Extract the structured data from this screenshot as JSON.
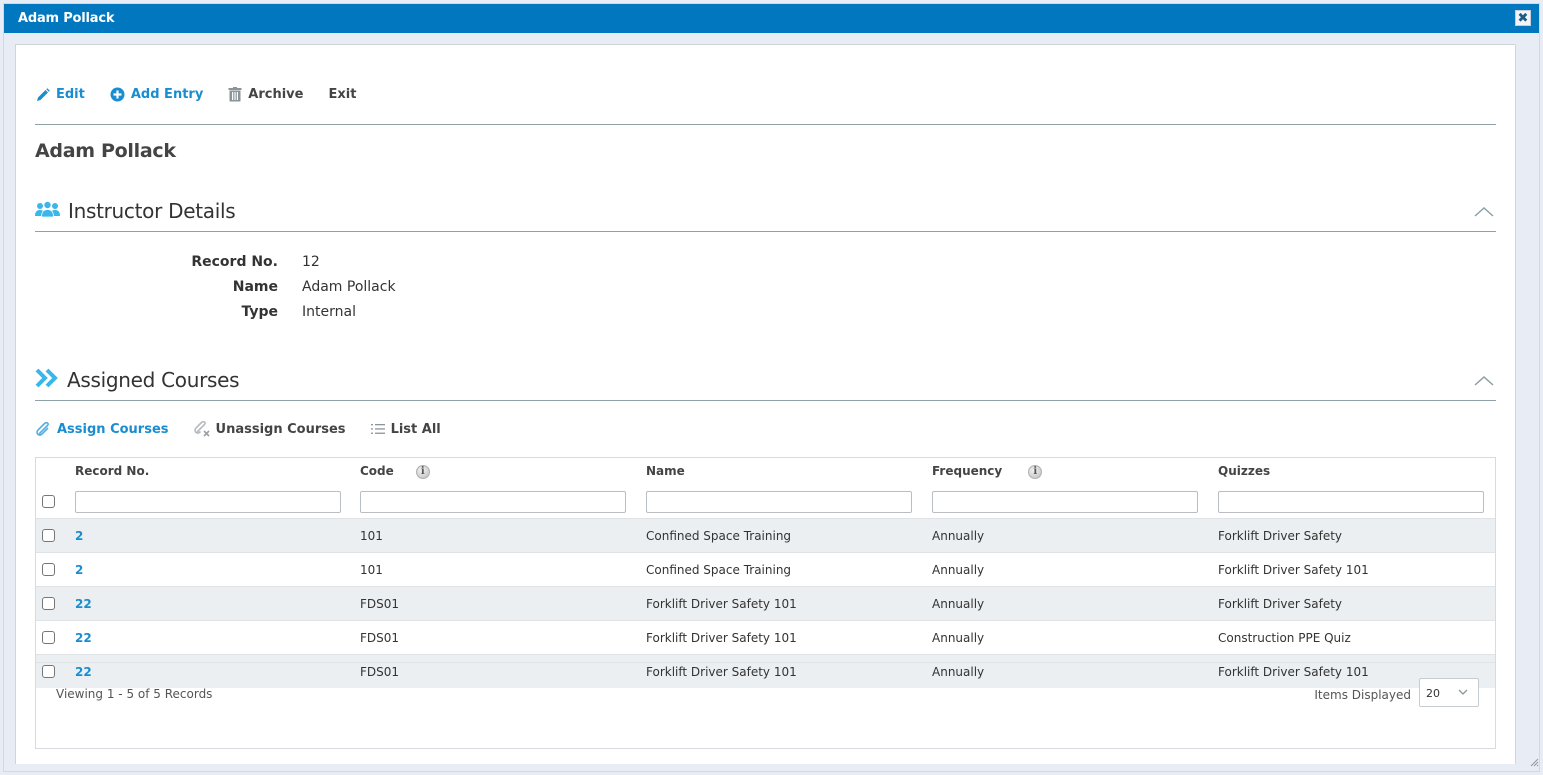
{
  "window": {
    "title": "Adam Pollack",
    "close_icon": "close-icon"
  },
  "toolbar": {
    "edit_label": "Edit",
    "add_entry_label": "Add Entry",
    "archive_label": "Archive",
    "exit_label": "Exit"
  },
  "record_title": "Adam Pollack",
  "instructor_details": {
    "title": "Instructor Details",
    "icon": "users-icon",
    "fields": [
      {
        "label": "Record No.",
        "value": "12"
      },
      {
        "label": "Name",
        "value": "Adam Pollack"
      },
      {
        "label": "Type",
        "value": "Internal"
      }
    ]
  },
  "assigned_courses": {
    "title": "Assigned Courses",
    "icon": "double-chevron-right-icon",
    "actions": {
      "assign_label": "Assign Courses",
      "unassign_label": "Unassign Courses",
      "list_all_label": "List All"
    },
    "columns": [
      {
        "label": "Record No.",
        "info": false
      },
      {
        "label": "Code",
        "info": true
      },
      {
        "label": "Name",
        "info": false
      },
      {
        "label": "Frequency",
        "info": true
      },
      {
        "label": "Quizzes",
        "info": false
      }
    ],
    "filters": [
      "",
      "",
      "",
      "",
      ""
    ],
    "rows": [
      {
        "record_no": "2",
        "code": "101",
        "name": "Confined Space Training",
        "frequency": "Annually",
        "quizzes": "Forklift Driver Safety"
      },
      {
        "record_no": "2",
        "code": "101",
        "name": "Confined Space Training",
        "frequency": "Annually",
        "quizzes": "Forklift Driver Safety 101"
      },
      {
        "record_no": "22",
        "code": "FDS01",
        "name": "Forklift Driver Safety 101",
        "frequency": "Annually",
        "quizzes": "Forklift Driver Safety"
      },
      {
        "record_no": "22",
        "code": "FDS01",
        "name": "Forklift Driver Safety 101",
        "frequency": "Annually",
        "quizzes": "Construction PPE Quiz"
      },
      {
        "record_no": "22",
        "code": "FDS01",
        "name": "Forklift Driver Safety 101",
        "frequency": "Annually",
        "quizzes": "Forklift Driver Safety 101"
      }
    ],
    "footer": {
      "viewing": "Viewing 1 - 5 of 5 Records",
      "items_displayed_label": "Items Displayed",
      "items_displayed_value": "20"
    }
  },
  "colors": {
    "titlebar": "#0077be",
    "link": "#1a8dd0",
    "alt_row": "#eceff1",
    "section_icon": "#3bb6ea"
  }
}
